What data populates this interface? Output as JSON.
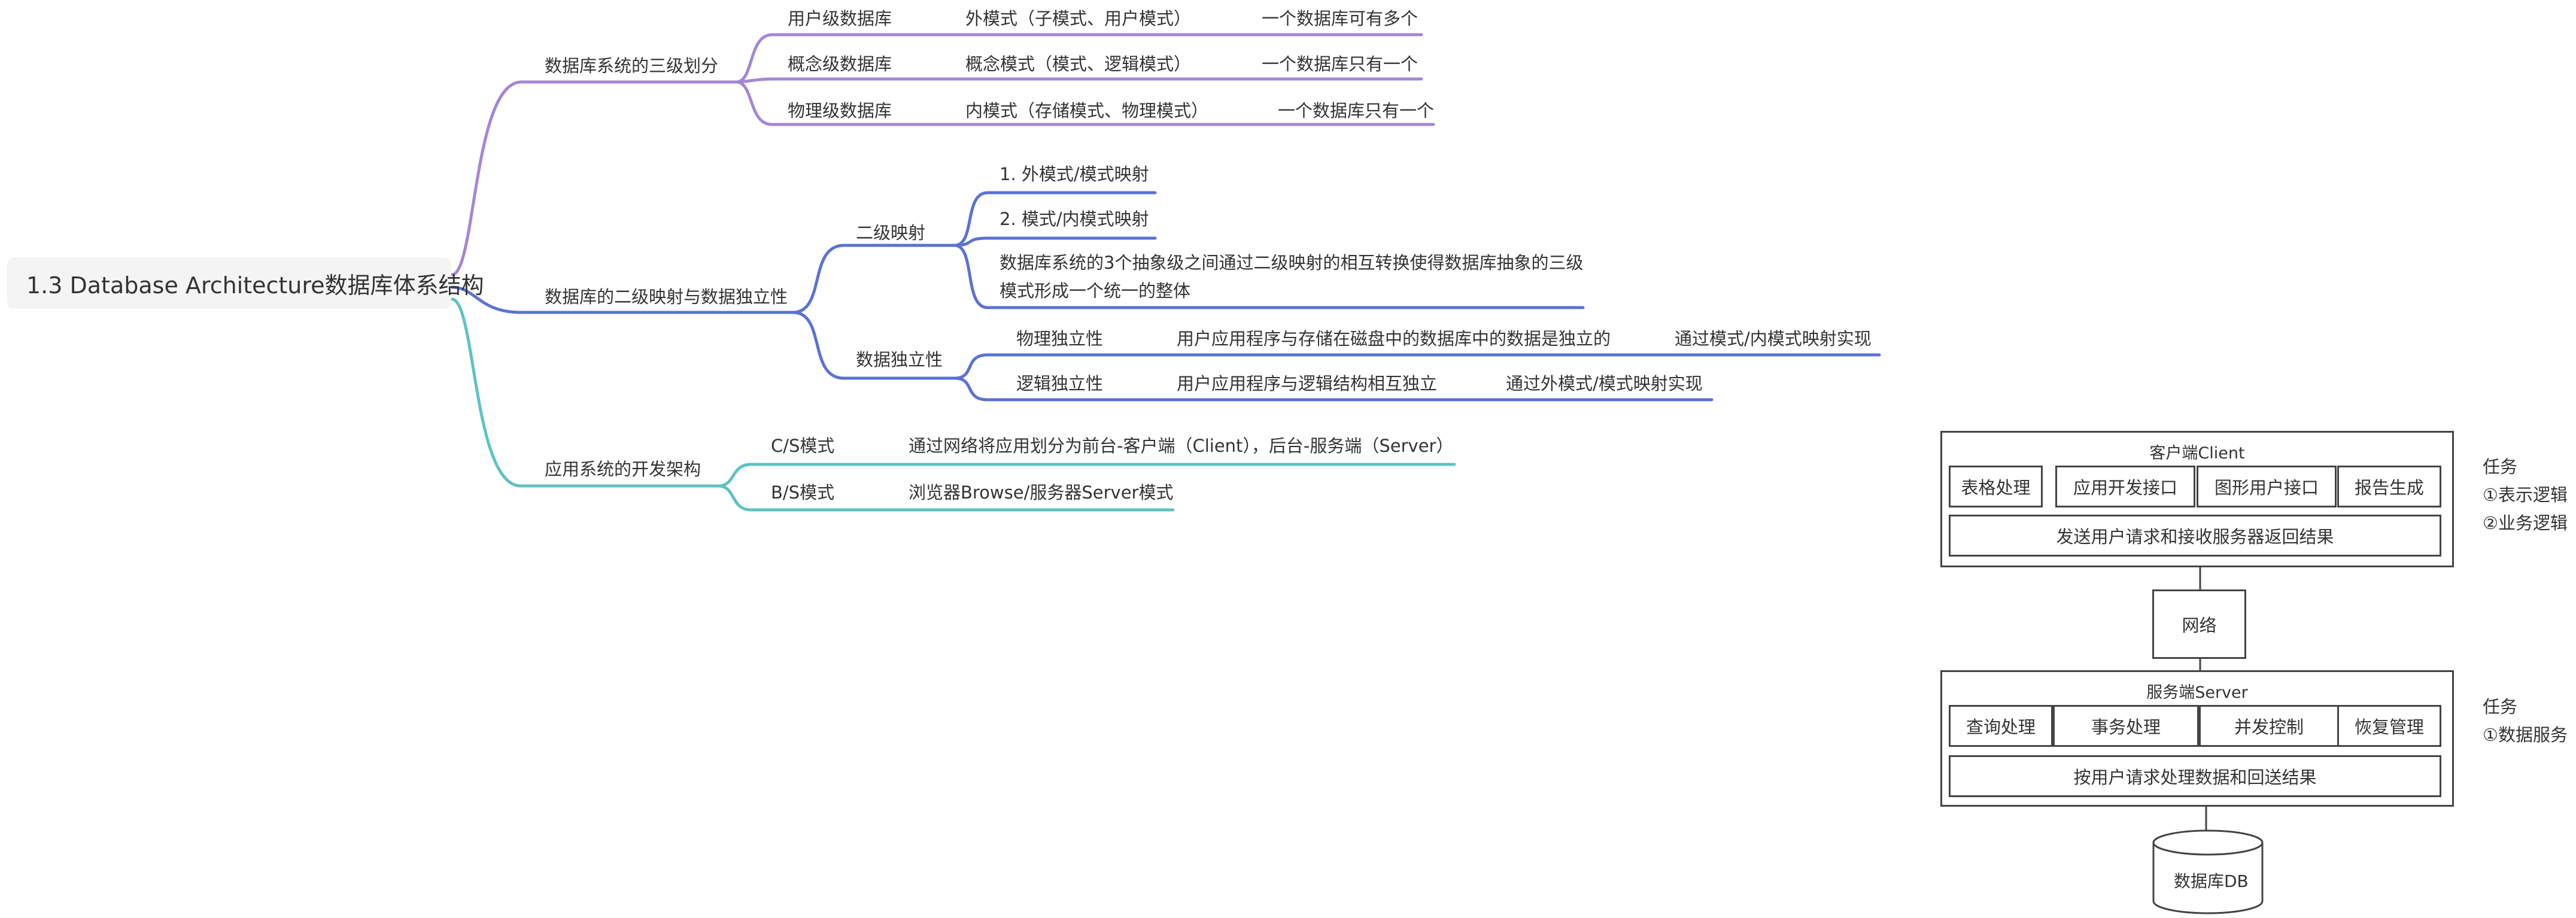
{
  "mindmap": {
    "root": "1.3 Database Architecture数据库体系结构",
    "colors": {
      "purple": "#a287d6",
      "blue": "#5b72d2",
      "teal": "#5ec2c2"
    },
    "three_level": {
      "label": "数据库系统的三级划分",
      "items": [
        {
          "level": "用户级数据库",
          "schema": "外模式（子模式、用户模式）",
          "note": "一个数据库可有多个"
        },
        {
          "level": "概念级数据库",
          "schema": "概念模式（模式、逻辑模式）",
          "note": "一个数据库只有一个"
        },
        {
          "level": "物理级数据库",
          "schema": "内模式（存储模式、物理模式）",
          "note": "一个数据库只有一个"
        }
      ]
    },
    "mapping": {
      "label": "数据库的二级映射与数据独立性",
      "two_level": {
        "label": "二级映射",
        "item1": "1. 外模式/模式映射",
        "item2": "2. 模式/内模式映射",
        "desc_line1": "数据库系统的3个抽象级之间通过二级映射的相互转换使得数据库抽象的三级",
        "desc_line2": "模式形成一个统一的整体"
      },
      "independence": {
        "label": "数据独立性",
        "physical": {
          "label": "物理独立性",
          "desc": "用户应用程序与存储在磁盘中的数据库中的数据是独立的",
          "how": "通过模式/内模式映射实现"
        },
        "logical": {
          "label": "逻辑独立性",
          "desc": "用户应用程序与逻辑结构相互独立",
          "how": "通过外模式/模式映射实现"
        }
      }
    },
    "app_arch": {
      "label": "应用系统的开发架构",
      "cs": {
        "label": "C/S模式",
        "desc": "通过网络将应用划分为前台-客户端（Client），后台-服务端（Server）"
      },
      "bs": {
        "label": "B/S模式",
        "desc": "浏览器Browse/服务器Server模式"
      }
    }
  },
  "cs_diagram": {
    "client": {
      "title": "客户端Client",
      "modules": [
        "表格处理",
        "应用开发接口",
        "图形用户接口",
        "报告生成"
      ],
      "bar": "发送用户请求和接收服务器返回结果",
      "task_title": "任务",
      "tasks": [
        "①表示逻辑",
        "②业务逻辑"
      ]
    },
    "network": "网络",
    "server": {
      "title": "服务端Server",
      "modules": [
        "查询处理",
        "事务处理",
        "并发控制",
        "恢复管理"
      ],
      "bar": "按用户请求处理数据和回送结果",
      "task_title": "任务",
      "tasks": [
        "①数据服务"
      ]
    },
    "db": "数据库DB"
  }
}
